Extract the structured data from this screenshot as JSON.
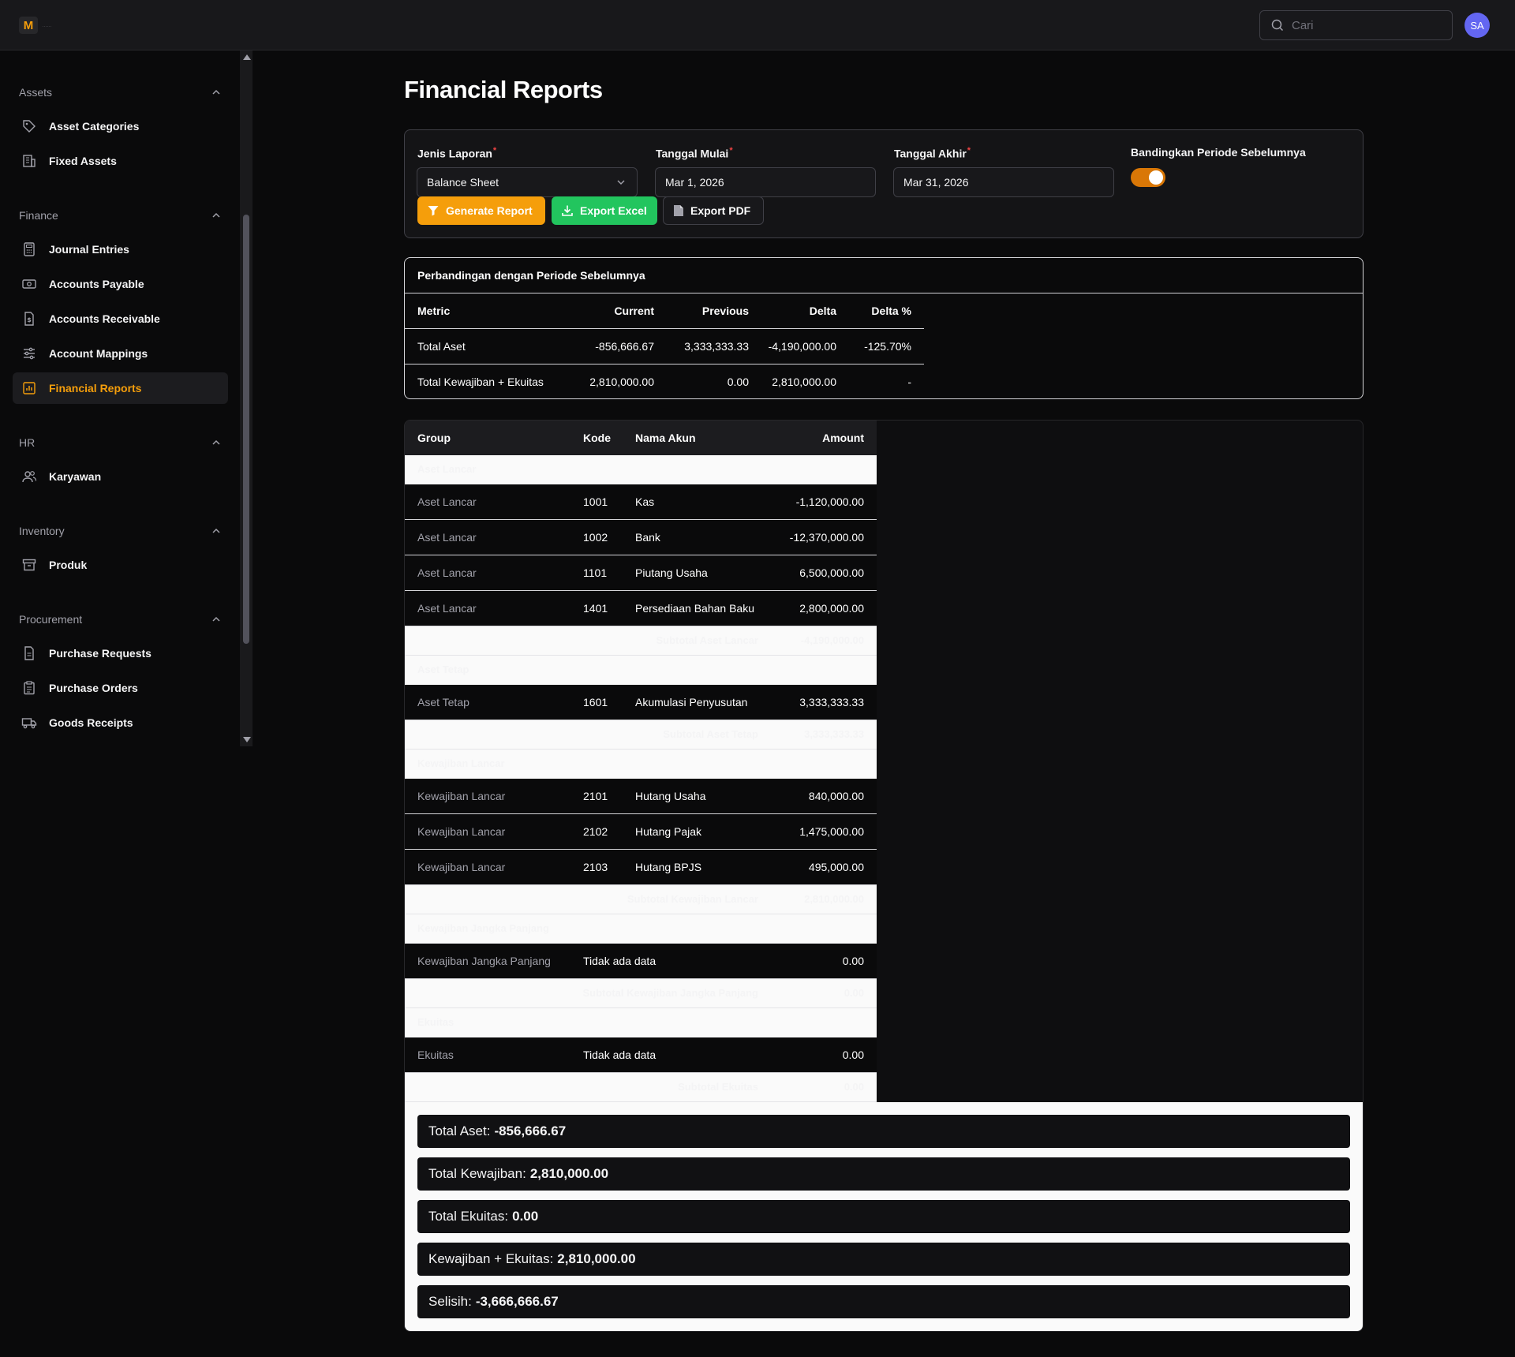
{
  "app": {
    "logo_letter": "M",
    "logo_text": "......"
  },
  "topbar": {
    "search_placeholder": "Cari",
    "avatar_initials": "SA"
  },
  "sidebar": {
    "groups": [
      {
        "title": "Assets",
        "items": [
          "Asset Categories",
          "Fixed Assets"
        ]
      },
      {
        "title": "Finance",
        "items": [
          "Journal Entries",
          "Accounts Payable",
          "Accounts Receivable",
          "Account Mappings",
          "Financial Reports"
        ]
      },
      {
        "title": "HR",
        "items": [
          "Karyawan"
        ]
      },
      {
        "title": "Inventory",
        "items": [
          "Produk"
        ]
      },
      {
        "title": "Procurement",
        "items": [
          "Purchase Requests",
          "Purchase Orders",
          "Goods Receipts"
        ]
      }
    ],
    "active_item": "Financial Reports",
    "accent_color": "#f59e0b"
  },
  "page": {
    "title": "Financial Reports"
  },
  "filters": {
    "report_type_label": "Jenis Laporan",
    "report_type_value": "Balance Sheet",
    "start_label": "Tanggal Mulai",
    "start_value": "Mar 1, 2026",
    "end_label": "Tanggal Akhir",
    "end_value": "Mar 31, 2026",
    "compare_label": "Bandingkan Periode Sebelumnya",
    "compare_enabled": true,
    "required_mark": "*",
    "generate_label": "Generate Report",
    "excel_label": "Export Excel",
    "pdf_label": "Export PDF"
  },
  "comparison": {
    "title": "Perbandingan dengan Periode Sebelumnya",
    "headers": [
      "Metric",
      "Current",
      "Previous",
      "Delta",
      "Delta %"
    ],
    "rows": [
      [
        "Total Aset",
        "-856,666.67",
        "3,333,333.33",
        "-4,190,000.00",
        "-125.70%"
      ],
      [
        "Total Kewajiban + Ekuitas",
        "2,810,000.00",
        "0.00",
        "2,810,000.00",
        "-"
      ]
    ]
  },
  "report_table": {
    "headers": [
      "Group",
      "Kode",
      "Nama Akun",
      "Amount"
    ],
    "sections": [
      {
        "group": "Aset Lancar",
        "rows": [
          [
            "Aset Lancar",
            "1001",
            "Kas",
            "-1,120,000.00"
          ],
          [
            "Aset Lancar",
            "1002",
            "Bank",
            "-12,370,000.00"
          ],
          [
            "Aset Lancar",
            "1101",
            "Piutang Usaha",
            "6,500,000.00"
          ],
          [
            "Aset Lancar",
            "1401",
            "Persediaan Bahan Baku",
            "2,800,000.00"
          ]
        ],
        "subtotal_label": "Subtotal Aset Lancar",
        "subtotal_value": "-4,190,000.00"
      },
      {
        "group": "Aset Tetap",
        "rows": [
          [
            "Aset Tetap",
            "1601",
            "Akumulasi Penyusutan",
            "3,333,333.33"
          ]
        ],
        "subtotal_label": "Subtotal Aset Tetap",
        "subtotal_value": "3,333,333.33"
      },
      {
        "group": "Kewajiban Lancar",
        "rows": [
          [
            "Kewajiban Lancar",
            "2101",
            "Hutang Usaha",
            "840,000.00"
          ],
          [
            "Kewajiban Lancar",
            "2102",
            "Hutang Pajak",
            "1,475,000.00"
          ],
          [
            "Kewajiban Lancar",
            "2103",
            "Hutang BPJS",
            "495,000.00"
          ]
        ],
        "subtotal_label": "Subtotal Kewajiban Lancar",
        "subtotal_value": "2,810,000.00"
      },
      {
        "group": "Kewajiban Jangka Panjang",
        "rows": [
          [
            "Kewajiban Jangka Panjang",
            "",
            "Tidak ada data",
            "0.00"
          ]
        ],
        "subtotal_label": "Subtotal Kewajiban Jangka Panjang",
        "subtotal_value": "0.00"
      },
      {
        "group": "Ekuitas",
        "rows": [
          [
            "Ekuitas",
            "",
            "Tidak ada data",
            "0.00"
          ]
        ],
        "subtotal_label": "Subtotal Ekuitas",
        "subtotal_value": "0.00"
      }
    ]
  },
  "totals": [
    {
      "label": "Total Aset:",
      "value": "-856,666.67"
    },
    {
      "label": "Total Kewajiban:",
      "value": "2,810,000.00"
    },
    {
      "label": "Total Ekuitas:",
      "value": "0.00"
    },
    {
      "label": "Kewajiban + Ekuitas:",
      "value": "2,810,000.00"
    },
    {
      "label": "Selisih:",
      "value": "-3,666,666.67"
    }
  ]
}
